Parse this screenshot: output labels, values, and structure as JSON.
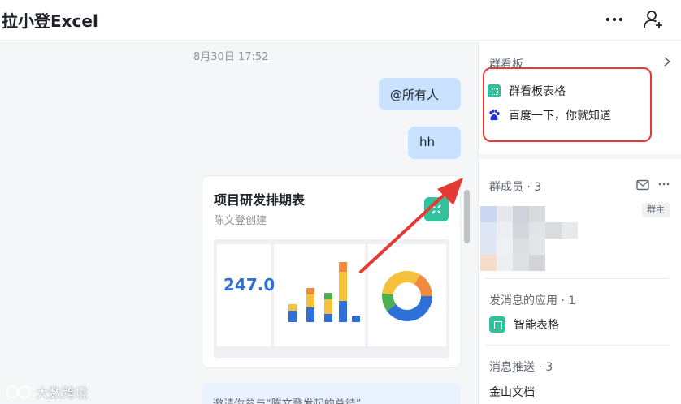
{
  "header": {
    "title": "拉小登Excel"
  },
  "chat": {
    "timestamp": "8月30日 17:52",
    "messages": [
      {
        "text": "@所有人"
      },
      {
        "text": "hh"
      }
    ],
    "card": {
      "title": "项目研发排期表",
      "subtitle": "陈文登创建",
      "preview_value": "247.0"
    },
    "invite_text": "邀请你参与“陈文登发起的总结”"
  },
  "watermark": {
    "text": "大数跨境"
  },
  "sidebar": {
    "board": {
      "title": "群看板",
      "items": [
        {
          "label": "群看板表格",
          "icon": "sheet-icon"
        },
        {
          "label": "百度一下，你就知道",
          "icon": "baidu-icon"
        }
      ]
    },
    "members": {
      "title": "群成员 · 3",
      "owner_badge": "群主"
    },
    "apps": {
      "title": "发消息的应用 · 1",
      "items": [
        {
          "label": "智能表格",
          "icon": "smart-sheet-icon"
        }
      ]
    },
    "push": {
      "title": "消息推送 · 3",
      "items": [
        {
          "label": "金山文档"
        }
      ]
    }
  },
  "colors": {
    "accent": "#2fc29b",
    "bubble": "#c8e2ff",
    "annotation": "#e53935"
  }
}
